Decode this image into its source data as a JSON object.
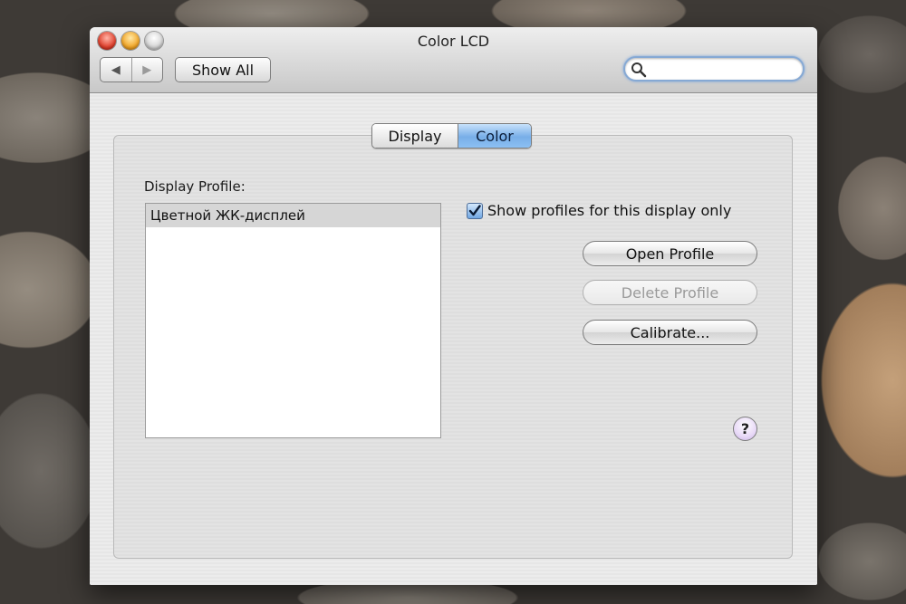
{
  "window": {
    "title": "Color LCD"
  },
  "toolbar": {
    "back_glyph": "◀",
    "forward_glyph": "▶",
    "show_all_label": "Show All",
    "search": {
      "value": "",
      "placeholder": ""
    }
  },
  "tabs": [
    {
      "label": "Display",
      "selected": false
    },
    {
      "label": "Color",
      "selected": true
    }
  ],
  "color_pane": {
    "display_profile_label": "Display Profile:",
    "profiles": [
      "Цветной ЖК-дисплей"
    ],
    "selected_profile": "Цветной ЖК-дисплей",
    "show_profiles_checkbox": {
      "label": "Show profiles for this display only",
      "checked": true
    },
    "buttons": {
      "open_profile": "Open Profile",
      "delete_profile": "Delete Profile",
      "calibrate": "Calibrate..."
    },
    "help_glyph": "?"
  },
  "colors": {
    "selected_tab": "#78aee8",
    "search_focus": "#86a9d4",
    "close_button": "#e0422f",
    "minimize_button": "#f2a72a"
  },
  "icons": [
    "search-icon",
    "checkmark-icon",
    "help-icon",
    "back-arrow-icon",
    "forward-arrow-icon"
  ]
}
